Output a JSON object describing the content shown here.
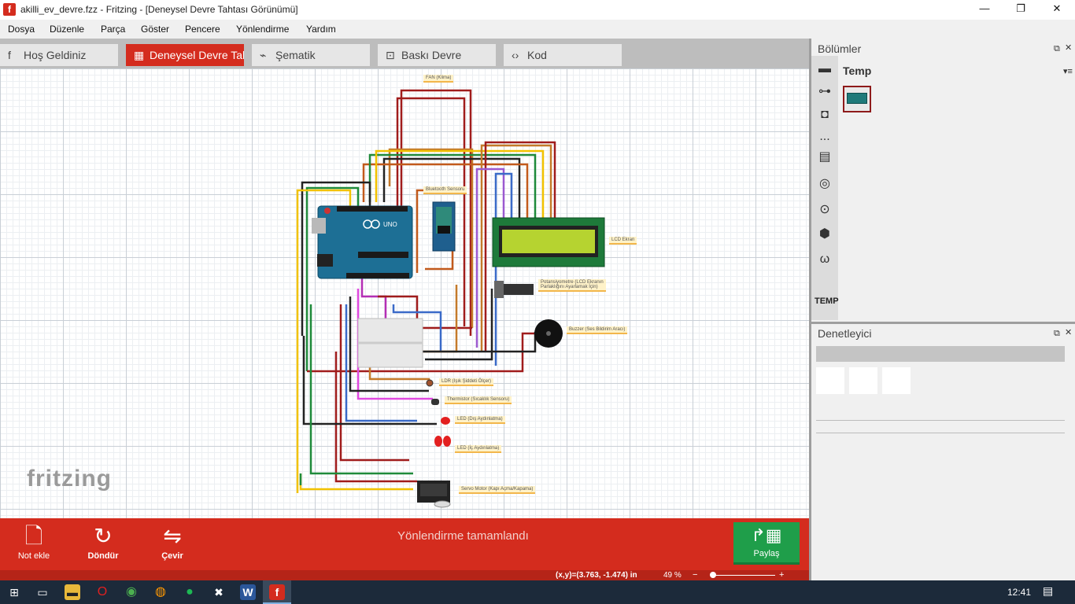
{
  "window": {
    "title": "akilli_ev_devre.fzz - Fritzing - [Deneysel Devre Tahtası Görünümü]",
    "app_icon_letter": "f",
    "minimize": "—",
    "maximize": "❐",
    "close": "✕"
  },
  "menu": [
    "Dosya",
    "Düzenle",
    "Parça",
    "Göster",
    "Pencere",
    "Yönlendirme",
    "Yardım"
  ],
  "tabs": [
    {
      "label": "Hoş Geldiniz",
      "icon": "f"
    },
    {
      "label": "Deneysel Devre Tahtası",
      "icon": "▦"
    },
    {
      "label": "Şematik",
      "icon": "⌁"
    },
    {
      "label": "Baskı Devre",
      "icon": "⊡"
    },
    {
      "label": "Kod",
      "icon": "‹›"
    }
  ],
  "canvas": {
    "watermark": "fritzing",
    "part_labels": [
      "FAN (Klima)",
      "Bluetooth Sensoru",
      "LCD Ekran",
      "Potansiyometre (LCD Ekranın Parlaklığını Ayarlamak İçin)",
      "Buzzer (Ses Bildirim Aracı)",
      "LDR (Işık Şiddeti Ölçer)",
      "Thermistor (Sıcaklık Sensoru)",
      "LED (Dış Aydınlatma)",
      "LED (İç Aydınlatma)",
      "Servo Motor (Kapı Açma/Kapama)"
    ]
  },
  "toolbar": {
    "note": "Not ekle",
    "rotate": "Döndür",
    "flip": "Çevir",
    "status": "Yönlendirme tamamlandı",
    "share": "Paylaş"
  },
  "statusbar": {
    "coords": "(x,y)=(3.763, -1.474) in",
    "zoom": "49 %",
    "zoom_minus": "−",
    "zoom_plus": "+"
  },
  "dock": {
    "parts_title": "Bölümler",
    "bin_title": "Temp",
    "bin_label": "TEMP",
    "bin_more": "...",
    "inspector_title": "Denetleyici"
  },
  "taskbar": {
    "clock": "12:41",
    "icons": [
      "windows-start",
      "task-view",
      "file-explorer",
      "opera",
      "chrome",
      "firefox",
      "spotify",
      "network-tool",
      "word",
      "fritzing"
    ]
  }
}
